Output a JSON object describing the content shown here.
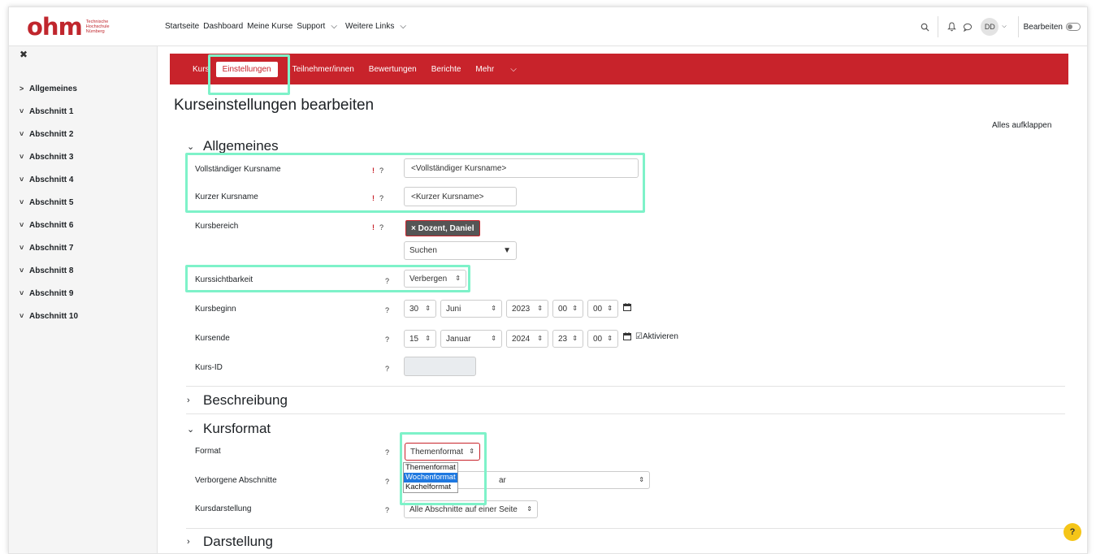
{
  "logo": {
    "mark": "ohm",
    "sub_line1": "Technische",
    "sub_line2": "Hochschule",
    "sub_line3": "Nürnberg"
  },
  "topnav": {
    "links": [
      "Startseite",
      "Dashboard",
      "Meine Kurse",
      "Support",
      "Weitere Links"
    ],
    "avatar": "DD",
    "edit_label": "Bearbeiten"
  },
  "sidebar": {
    "items": [
      {
        "label": "Allgemeines",
        "chevron": ">"
      },
      {
        "label": "Abschnitt 1",
        "chevron": "˅"
      },
      {
        "label": "Abschnitt 2",
        "chevron": "˅"
      },
      {
        "label": "Abschnitt 3",
        "chevron": "˅"
      },
      {
        "label": "Abschnitt 4",
        "chevron": "˅"
      },
      {
        "label": "Abschnitt 5",
        "chevron": "˅"
      },
      {
        "label": "Abschnitt 6",
        "chevron": "˅"
      },
      {
        "label": "Abschnitt 7",
        "chevron": "˅"
      },
      {
        "label": "Abschnitt 8",
        "chevron": "˅"
      },
      {
        "label": "Abschnitt 9",
        "chevron": "˅"
      },
      {
        "label": "Abschnitt 10",
        "chevron": "˅"
      }
    ]
  },
  "coursenav": {
    "kurs": "Kurs",
    "einstellungen": "Einstellungen",
    "teilnehmer": "Teilnehmer/innen",
    "bewertungen": "Bewertungen",
    "berichte": "Berichte",
    "mehr": "Mehr"
  },
  "page": {
    "title": "Kurseinstellungen bearbeiten",
    "expand_all": "Alles aufklappen"
  },
  "allgemeines": {
    "heading": "Allgemeines",
    "fullname_label": "Vollständiger Kursname",
    "fullname_value": "<Vollständiger Kursname>",
    "shortname_label": "Kurzer Kursname",
    "shortname_value": "<Kurzer Kursname>",
    "category_label": "Kursbereich",
    "category_chip": "× Dozent, Daniel",
    "category_search": "Suchen",
    "visibility_label": "Kurssichtbarkeit",
    "visibility_value": "Verbergen",
    "start_label": "Kursbeginn",
    "start_day": "30",
    "start_month": "Juni",
    "start_year": "2023",
    "start_hour": "00",
    "start_min": "00",
    "end_label": "Kursende",
    "end_day": "15",
    "end_month": "Januar",
    "end_year": "2024",
    "end_hour": "23",
    "end_min": "00",
    "end_enable": "Aktivieren",
    "idnumber_label": "Kurs-ID"
  },
  "beschreibung": {
    "heading": "Beschreibung"
  },
  "kursformat": {
    "heading": "Kursformat",
    "format_label": "Format",
    "format_value": "Themenformat",
    "format_options": [
      "Themenformat",
      "Wochenformat",
      "Kachelformat"
    ],
    "format_selected": 1,
    "hidden_label": "Verborgene Abschnitte",
    "hidden_value_tail": "ar",
    "layout_label": "Kursdarstellung",
    "layout_value": "Alle Abschnitte auf einer Seite"
  },
  "darstellung": {
    "heading": "Darstellung"
  },
  "icons": {
    "required": "!",
    "help": "?",
    "calendar": "calendar-icon",
    "search": "search-icon",
    "bell": "bell-icon",
    "chat": "chat-icon"
  },
  "colors": {
    "brand_red": "#c8232b",
    "highlight": "#7ef2c9",
    "selected_option": "#1e78e0",
    "help_fab": "#f5c518"
  },
  "help_fab": "?"
}
